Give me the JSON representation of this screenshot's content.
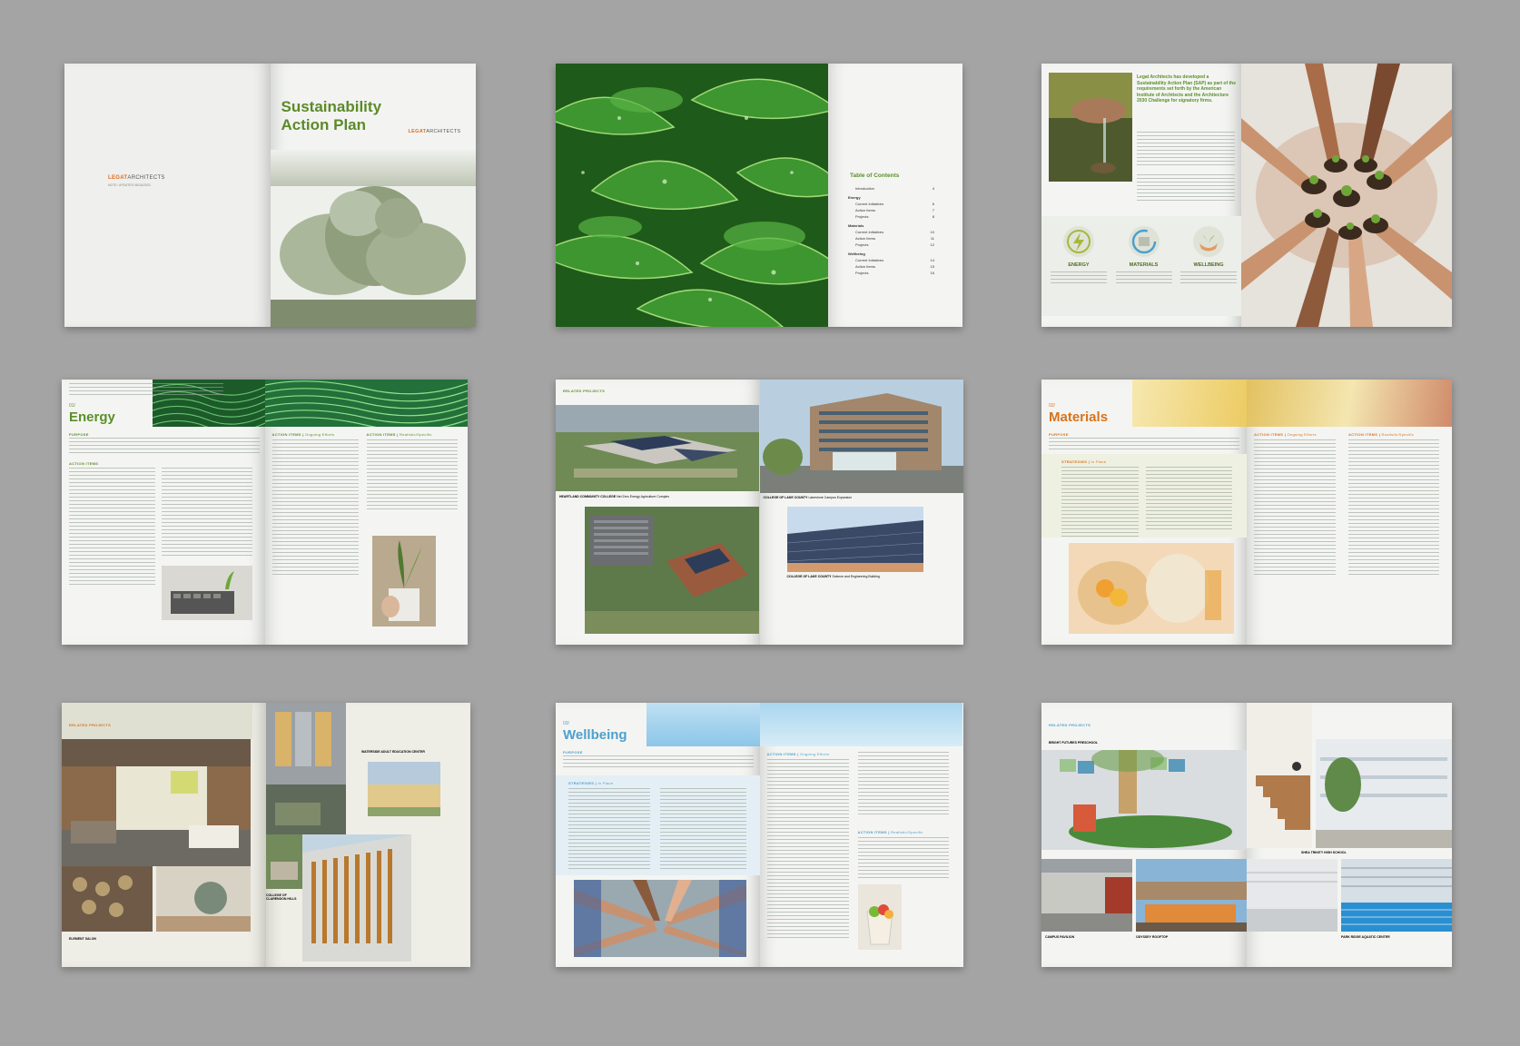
{
  "colors": {
    "background": "#a4a4a4",
    "energy_green": "#5a8f2a",
    "materials_orange": "#d9731c",
    "wellbeing_blue": "#4f9fcf",
    "brand_orange": "#e06b1d"
  },
  "cover": {
    "title_line1": "Sustainability",
    "title_line2": "Action Plan",
    "logo_bold": "LEGAT",
    "logo_light": "ARCHITECTS",
    "back_logo_bold": "LEGAT",
    "back_logo_light": "ARCHITECTS",
    "back_subtitle": "NOTE: UPDATED 08/16/2023"
  },
  "toc": {
    "heading": "Table of Contents",
    "items": [
      {
        "label": "Introduction",
        "page": "4"
      },
      {
        "label": "Energy",
        "page": ""
      },
      {
        "label": "Current Initiatives",
        "page": "6"
      },
      {
        "label": "Action Items",
        "page": "7"
      },
      {
        "label": "Projects",
        "page": "8"
      },
      {
        "label": "Materials",
        "page": ""
      },
      {
        "label": "Current Initiatives",
        "page": "10"
      },
      {
        "label": "Action Items",
        "page": "11"
      },
      {
        "label": "Projects",
        "page": "12"
      },
      {
        "label": "Wellbeing",
        "page": ""
      },
      {
        "label": "Current Initiatives",
        "page": "14"
      },
      {
        "label": "Action Items",
        "page": "15"
      },
      {
        "label": "Projects",
        "page": "16"
      }
    ]
  },
  "intro": {
    "headline": "Legat Architects has developed a Sustainability Action Plan (SAP) as part of the requirements set forth by the American Institute of Architects and the Architecture 2030 Challenge for signatory firms.",
    "pillars": [
      {
        "label": "ENERGY",
        "icon": "lightning-icon"
      },
      {
        "label": "MATERIALS",
        "icon": "recycle-icon"
      },
      {
        "label": "WELLBEING",
        "icon": "hands-plant-icon"
      }
    ]
  },
  "energy": {
    "number": "01/",
    "title": "Energy",
    "purpose": "PURPOSE",
    "action_items": "ACTION ITEMS",
    "action_items_ongoing": "ACTION ITEMS",
    "ongoing_tag": "Ongoing Efforts",
    "action_items_realistic": "ACTION ITEMS",
    "realistic_tag": "Realistic/Specific"
  },
  "energy_projects": {
    "kicker": "RELATED PROJECTS",
    "caption1": "HEARTLAND COMMUNITY COLLEGE",
    "caption1_sub": "Net Zero Energy Agriculture Complex",
    "caption2": "COLLEGE OF LAKE COUNTY",
    "caption2_sub": "Lakeshore Campus Expansion",
    "caption3": "COLLEGE OF LAKE COUNTY",
    "caption3_sub": "Science and Engineering Building"
  },
  "materials": {
    "number": "02/",
    "title": "Materials",
    "purpose": "PURPOSE",
    "strategies": "STRATEGIES",
    "strategies_tag": "In Place",
    "action_items_ongoing": "ACTION ITEMS",
    "ongoing_tag": "Ongoing Efforts",
    "action_items_realistic": "ACTION ITEMS",
    "realistic_tag": "Realistic/Specific"
  },
  "materials_projects": {
    "kicker": "RELATED PROJECTS",
    "caption1": "WATERSIDE ADULT EDUCATION CENTER",
    "caption2": "COLLEGE OF CLARENDON HILLS",
    "caption3": "ELEMENT SALON"
  },
  "wellbeing": {
    "number": "03/",
    "title": "Wellbeing",
    "purpose": "PURPOSE",
    "strategies": "STRATEGIES",
    "strategies_tag": "In Place",
    "action_items_ongoing": "ACTION ITEMS",
    "ongoing_tag": "Ongoing Efforts",
    "action_items_realistic": "ACTION ITEMS",
    "realistic_tag": "Realistic/Specific"
  },
  "wellbeing_projects": {
    "kicker": "RELATED PROJECTS",
    "caption1": "BRIGHT FUTURES PRESCHOOL",
    "caption2": "CAMPUS PAVILION",
    "caption3": "ODYSSEY ROOFTOP",
    "caption4": "SHEA TRINITY HIGH SCHOOL",
    "caption5": "PARK RIDGE AQUATIC CENTER"
  }
}
